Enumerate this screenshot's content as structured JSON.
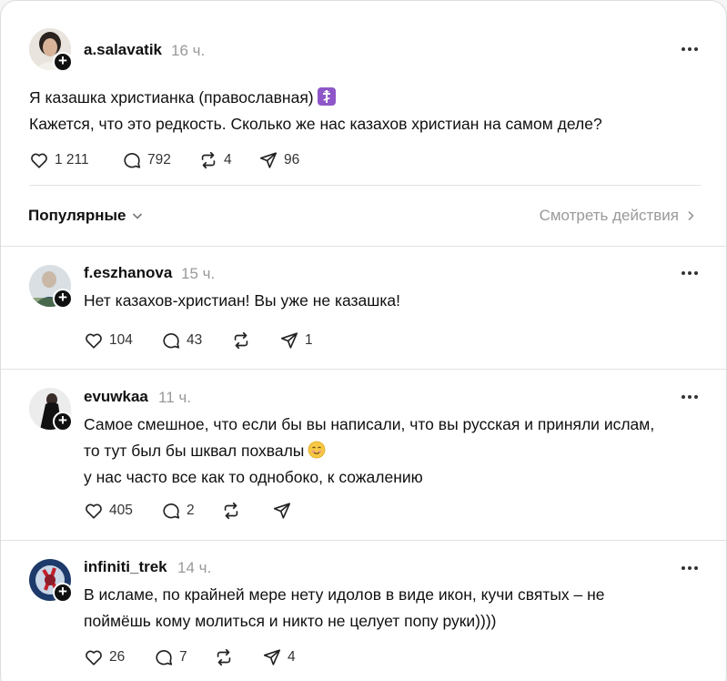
{
  "main_post": {
    "username": "a.salavatik",
    "time": "16 ч.",
    "line1": "Я казашка христианка (православная)",
    "line2": "Кажется, что это редкость. Сколько же нас казахов христиан на самом деле?",
    "likes": "1 211",
    "replies": "792",
    "reposts": "4",
    "shares": "96"
  },
  "sort": {
    "label": "Популярные",
    "activity_label": "Смотреть действия"
  },
  "comments": [
    {
      "username": "f.eszhanova",
      "time": "15 ч.",
      "lines": [
        "Нет казахов-христиан! Вы уже не казашка!"
      ],
      "likes": "104",
      "replies": "43",
      "reposts": "",
      "shares": "1"
    },
    {
      "username": "evuwkaa",
      "time": "11 ч.",
      "lines": [
        "Самое смешное, что если бы вы написали, что вы русская и приняли ислам,",
        "то тут был бы шквал похвалы",
        "у нас часто все как то однобоко, к сожалению"
      ],
      "likes": "405",
      "replies": "2",
      "reposts": "",
      "shares": ""
    },
    {
      "username": "infiniti_trek",
      "time": "14 ч.",
      "lines": [
        "В исламе, по крайней мере нету идолов в виде икон, кучи святых – не",
        "поймёшь кому молиться и никто не целует попу руки))))"
      ],
      "likes": "26",
      "replies": "7",
      "reposts": "",
      "shares": "4"
    }
  ],
  "icons": {
    "like": "heart-icon",
    "reply": "comment-bubble-icon",
    "repost": "repost-arrows-icon",
    "share": "send-paper-plane-icon",
    "more": "more-dots-icon",
    "follow": "plus-icon",
    "cross_emoji": "orthodox-cross-emoji",
    "smile_emoji": "smiling-face-emoji"
  }
}
